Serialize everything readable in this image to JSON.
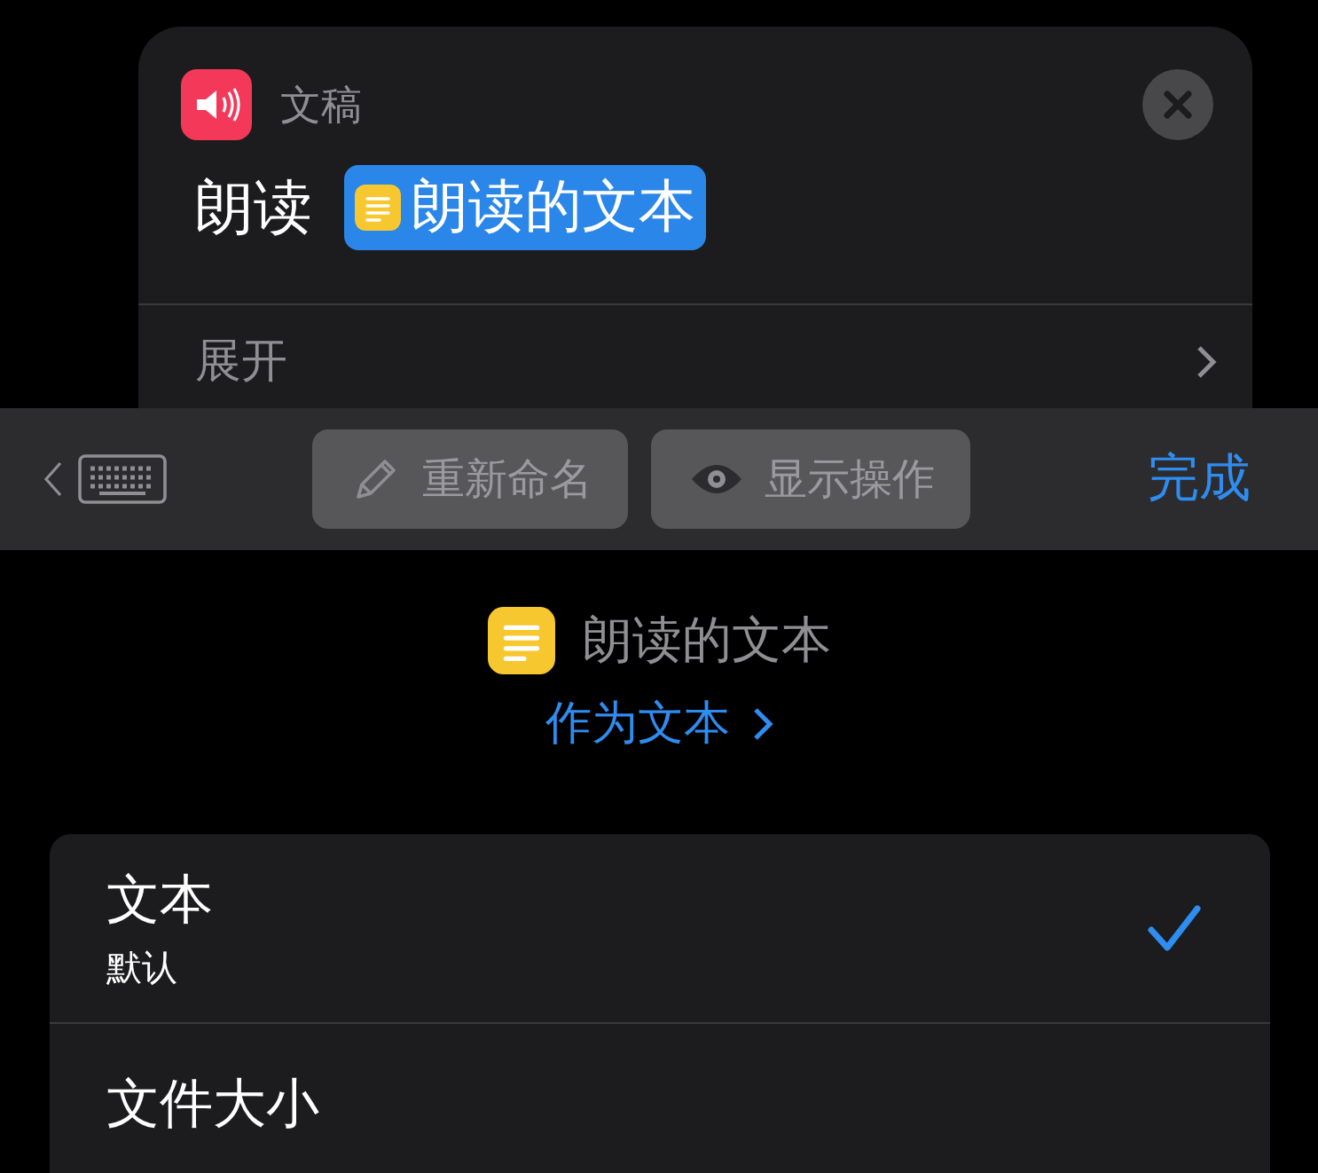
{
  "action_card": {
    "app_label": "文稿",
    "verb": "朗读",
    "token": "朗读的文本",
    "row": "展开"
  },
  "toolbar": {
    "buttons": [
      {
        "label": "重新命名",
        "kind": "pencil"
      },
      {
        "label": "显示操作",
        "kind": "eye"
      }
    ],
    "done": "完成"
  },
  "variable": {
    "name": "朗读的文本",
    "type_link": "作为文本"
  },
  "options": [
    {
      "title": "文本",
      "subtitle": "默认",
      "selected": true
    },
    {
      "title": "文件大小",
      "selected": false
    }
  ]
}
